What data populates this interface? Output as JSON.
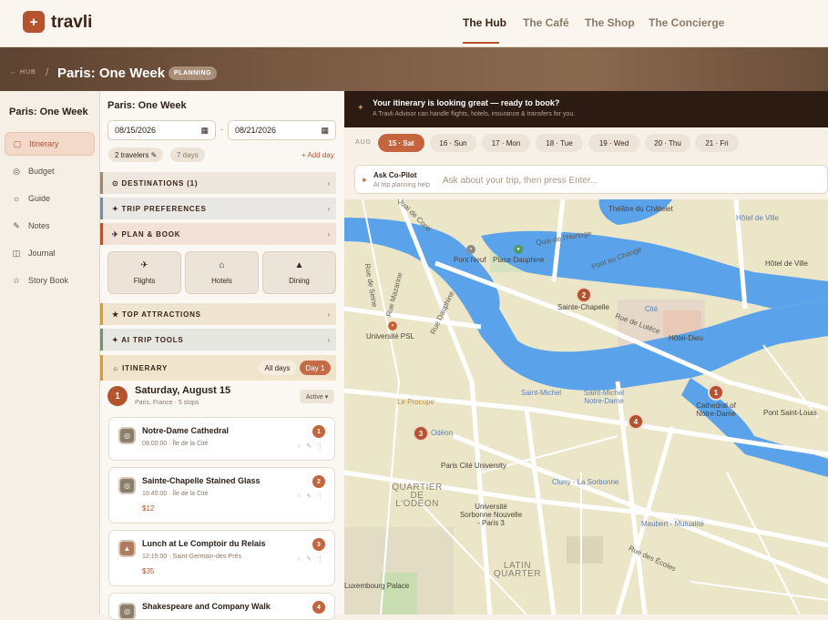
{
  "header": {
    "logo_glyph": "+",
    "brand": "travli",
    "nav": [
      "The Hub",
      "The Café",
      "The Shop",
      "The Concierge"
    ],
    "active_nav": "The Hub"
  },
  "banner": {
    "breadcrumb": "← HUB",
    "separator": "/",
    "title": "Paris: One Week",
    "status_badge": "PLANNING"
  },
  "sidebar": {
    "trip_title": "Paris: One Week",
    "items": [
      {
        "label": "Itinerary",
        "icon": "calendar-icon",
        "glyph": "▢",
        "active": true
      },
      {
        "label": "Budget",
        "icon": "coin-icon",
        "glyph": "◎"
      },
      {
        "label": "Guide",
        "icon": "compass-icon",
        "glyph": "☼"
      },
      {
        "label": "Notes",
        "icon": "pencil-icon",
        "glyph": "✎"
      },
      {
        "label": "Journal",
        "icon": "book-icon",
        "glyph": "◫"
      },
      {
        "label": "Story Book",
        "icon": "star-icon",
        "glyph": "☆"
      }
    ]
  },
  "planner": {
    "title": "Paris: One Week",
    "start_date": "08/15/2026",
    "end_date": "08/21/2026",
    "date_separator": "-",
    "travelers": "2 travelers ✎",
    "duration": "7 days",
    "add_day": "+ Add day",
    "sections": {
      "destinations": "⊙ DESTINATIONS (1)",
      "preferences": "✦ TRIP PREFERENCES",
      "plan_book": "✈ PLAN & BOOK",
      "attractions": "★ TOP ATTRACTIONS",
      "ai_tools": "✦ AI TRIP TOOLS",
      "itinerary": "☼ ITINERARY"
    },
    "book_buttons": [
      {
        "label": "Flights",
        "icon": "plane-icon",
        "glyph": "✈"
      },
      {
        "label": "Hotels",
        "icon": "home-icon",
        "glyph": "⌂"
      },
      {
        "label": "Dining",
        "icon": "bell-icon",
        "glyph": "▲"
      }
    ],
    "itinerary_toggle": {
      "all": "All days",
      "day": "Day 1"
    },
    "day": {
      "number": "1",
      "title": "Saturday, August 15",
      "subtitle": "Paris, France · 5 stops",
      "status": "Active ▾"
    },
    "stops": [
      {
        "num": "1",
        "name": "Notre-Dame Cathedral",
        "time": "09:00:00",
        "place": "Île de la Cité",
        "price": ""
      },
      {
        "num": "2",
        "name": "Sainte-Chapelle Stained Glass",
        "time": "10:45:00",
        "place": "Île de la Cité",
        "price": "$12"
      },
      {
        "num": "3",
        "name": "Lunch at Le Comptoir du Relais",
        "time": "12:15:00",
        "place": "Saint-Germain-des-Prés",
        "price": "$35"
      },
      {
        "num": "4",
        "name": "Shakespeare and Company Walk",
        "time": "",
        "place": "",
        "price": ""
      }
    ]
  },
  "promo": {
    "title": "Your itinerary is looking great — ready to book?",
    "subtitle": "A Travli Advisor can handle flights, hotels, insurance & transfers for you."
  },
  "day_strip": {
    "month": "AUG",
    "days": [
      "15 · Sat",
      "16 · Sun",
      "17 · Mon",
      "18 · Tue",
      "19 · Wed",
      "20 · Thu",
      "21 · Fri"
    ],
    "selected_index": 0
  },
  "copilot": {
    "title": "Ask Co-Pilot",
    "subtitle": "AI trip planning help",
    "placeholder": "Ask about your trip, then press Enter..."
  },
  "map": {
    "labels": {
      "quai_conti": "Quai de Conti",
      "pont_neuf": "Pont Neuf",
      "place_dauphine": "Place Dauphine",
      "quai_horloge": "Quai de l'Horloge",
      "pont_au_change": "Pont au Change",
      "theatre": "Théâtre du Châtelet",
      "hotel_de_ville_m": "Hôtel de Ville",
      "hotel_de_ville": "Hôtel de Ville",
      "rue_seine": "Rue de Seine",
      "rue_mazarine": "Rue Mazarine",
      "rue_dauphine": "Rue Dauphine",
      "sainte_chapelle": "Sainte-Chapelle",
      "cite": "Cité",
      "rue_lutece": "Rue de Lutèce",
      "hotel_dieu": "Hôtel-Dieu",
      "univ_psl": "Université PSL",
      "le_procope": "Le Procope",
      "saint_michel": "Saint-Michel",
      "saint_michel_nd": "Saint-Michel Notre-Dame",
      "odeon": "Odéon",
      "cathedral": "Cathedral of Notre-Dame",
      "pont_saint_louis": "Pont Saint-Louis",
      "paris_cite": "Paris Cité University",
      "sorbonne": "Université Sorbonne Nouvelle - Paris 3",
      "cluny": "Cluny - La Sorbonne",
      "quartier_odeon": "QUARTIER DE L'ODÉON",
      "maubert": "Maubert - Mutualité",
      "latin_quarter": "LATIN QUARTER",
      "rue_ecoles": "Rue des Écoles",
      "luxembourg": "Luxembourg Palace"
    },
    "pins": [
      "1",
      "2",
      "3",
      "4"
    ],
    "colors": {
      "water": "#5aa3ea",
      "land": "#ece6c9",
      "road": "#ffffff",
      "park": "#c9ddb3"
    }
  }
}
